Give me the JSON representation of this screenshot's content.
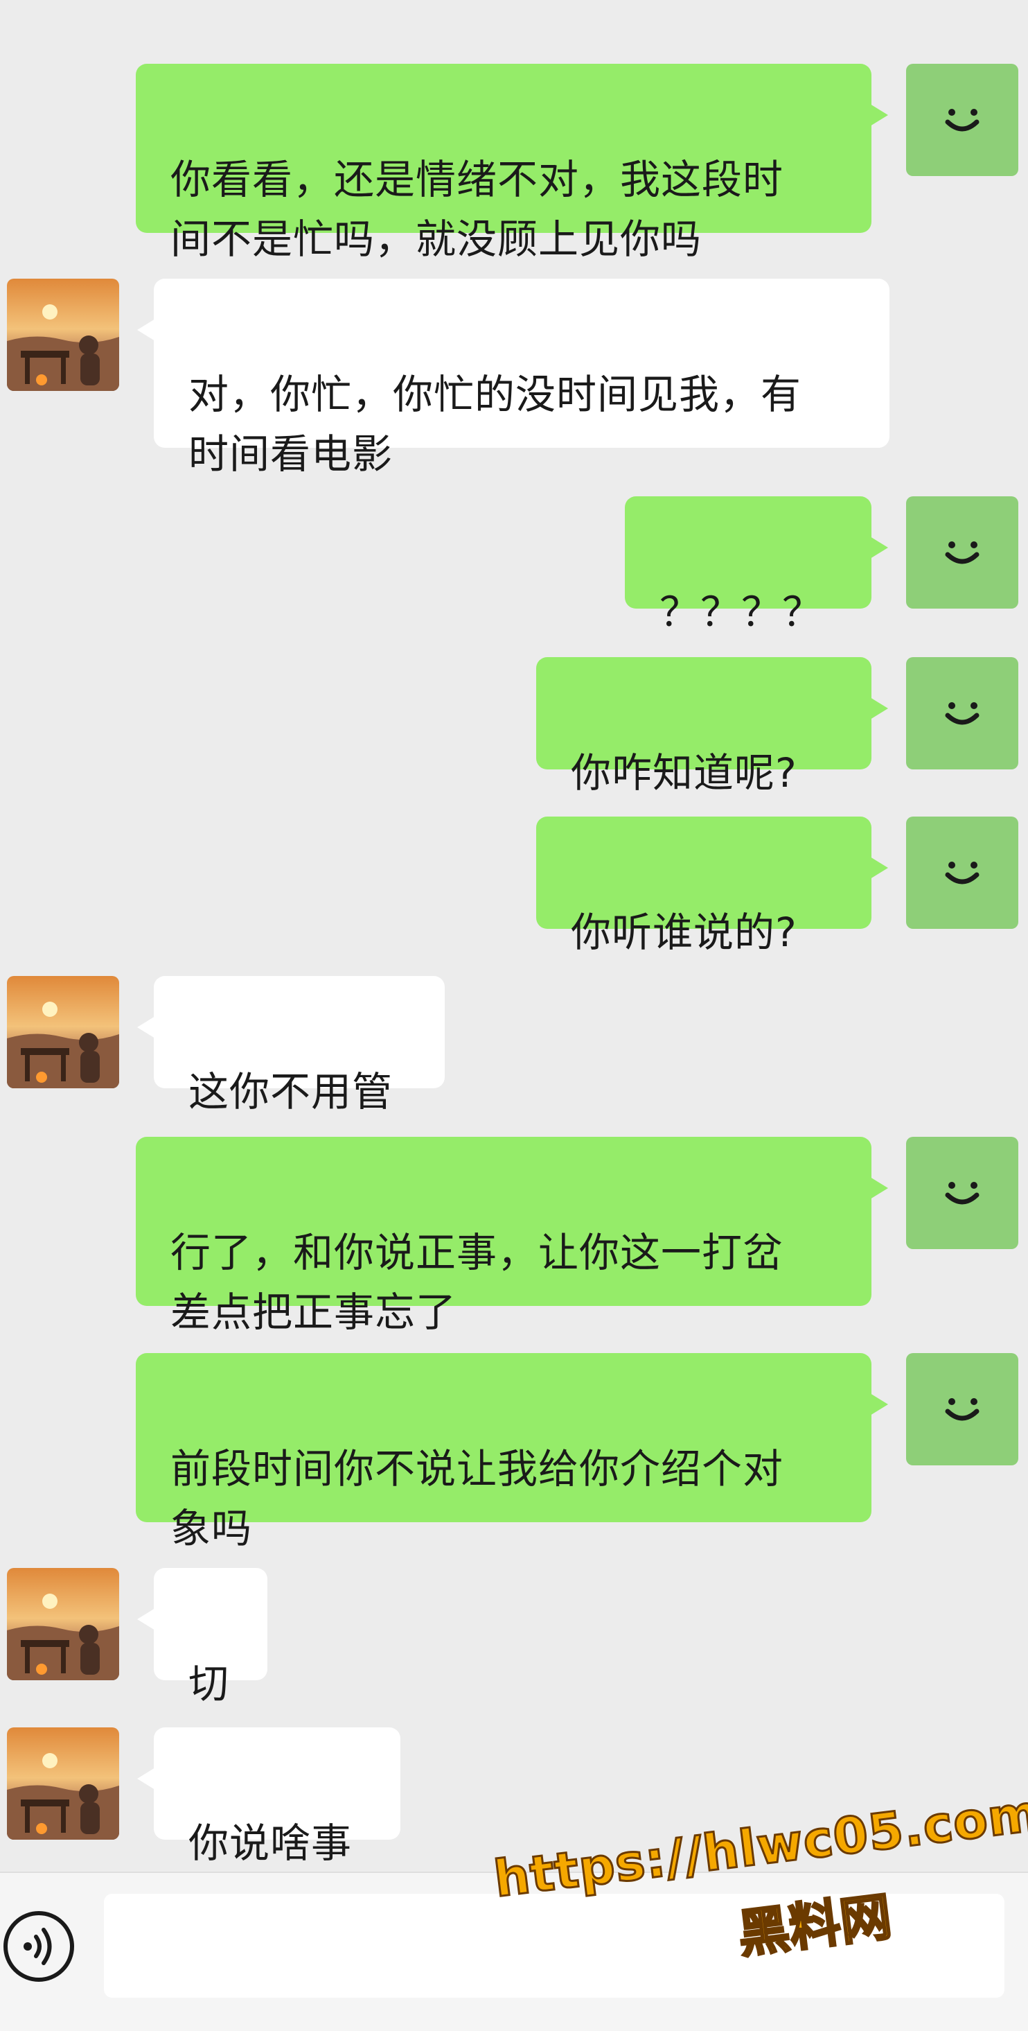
{
  "messages": [
    {
      "sender": "me",
      "text": "你看看，还是情绪不对，我这段时\n间不是忙吗，就没顾上见你吗"
    },
    {
      "sender": "them",
      "text": "对，你忙，你忙的没时间见我，有\n时间看电影"
    },
    {
      "sender": "me",
      "text": "？？？？"
    },
    {
      "sender": "me",
      "text": "你咋知道呢?"
    },
    {
      "sender": "me",
      "text": "你听谁说的?"
    },
    {
      "sender": "them",
      "text": "这你不用管"
    },
    {
      "sender": "me",
      "text": "行了，和你说正事，让你这一打岔\n差点把正事忘了"
    },
    {
      "sender": "me",
      "text": "前段时间你不说让我给你介绍个对\n象吗"
    },
    {
      "sender": "them",
      "text": "切"
    },
    {
      "sender": "them",
      "text": "你说啥事"
    }
  ],
  "watermark": {
    "url": "https://hlwc05.com",
    "brand": "黑料网"
  },
  "icons": {
    "my_avatar": "smiley-face-icon",
    "their_avatar": "sunset-photo-icon",
    "voice": "voice-input-icon"
  },
  "colors": {
    "my_bubble": "#95ec69",
    "their_bubble": "#ffffff",
    "background": "#ececec"
  }
}
